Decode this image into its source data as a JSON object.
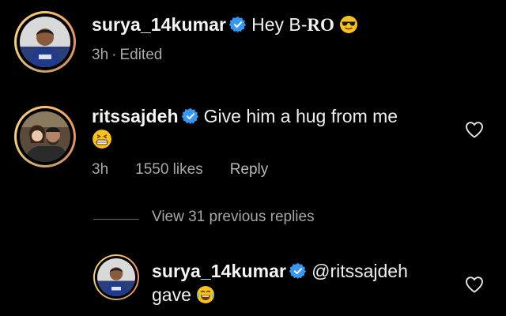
{
  "comment_top": {
    "username": "surya_14kumar",
    "text_plain": "Hey B-",
    "text_bold": "RO",
    "emoji": "sunglasses-emoji",
    "time": "3h",
    "edited": "Edited",
    "separator": "·"
  },
  "comment_main": {
    "username": "ritssajdeh",
    "text": "Give him a hug from me",
    "emoji": "grinning-emoji",
    "time": "3h",
    "likes": "1550 likes",
    "reply": "Reply"
  },
  "replies": {
    "view_label": "View 31 previous replies"
  },
  "reply": {
    "username": "surya_14kumar",
    "mention": "@ritssajdeh",
    "text": "gave",
    "emoji": "laughing-tears-emoji"
  },
  "colors": {
    "background": "#000000",
    "text": "#f2f2f2",
    "muted": "#a8a8a8",
    "verified": "#3897f0"
  }
}
